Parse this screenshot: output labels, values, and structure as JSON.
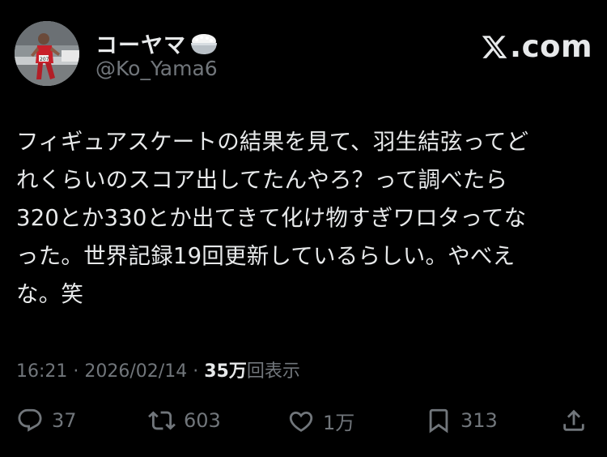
{
  "author": {
    "display_name": "コーヤマ",
    "handle": "@Ko_Yama6",
    "name_emoji": "rice-bowl-icon",
    "avatar_bib": "207"
  },
  "brand": {
    "text": ".com",
    "icon": "x-logo-icon"
  },
  "tweet": {
    "text": "フィギュアスケートの結果を見て、羽生結弦ってど\nれくらいのスコア出してたんやろ？って調べたら\n320とか330とか出てきて化け物すぎワロタってな\nった。世界記録19回更新しているらしい。やべえ\nな。笑"
  },
  "meta": {
    "time": "16:21",
    "separator1": " · ",
    "date": "2026/02/14",
    "separator2": " · ",
    "views_count": "35",
    "views_unit": "万",
    "views_label": "回表示"
  },
  "actions": {
    "reply": {
      "icon": "reply-icon",
      "count": "37"
    },
    "retweet": {
      "icon": "retweet-icon",
      "count": "603"
    },
    "like": {
      "icon": "heart-icon",
      "count": "1万"
    },
    "bookmark": {
      "icon": "bookmark-icon",
      "count": "313"
    },
    "share": {
      "icon": "share-icon"
    }
  },
  "colors": {
    "background": "#000000",
    "text": "#e7e9ea",
    "muted": "#71767b"
  }
}
